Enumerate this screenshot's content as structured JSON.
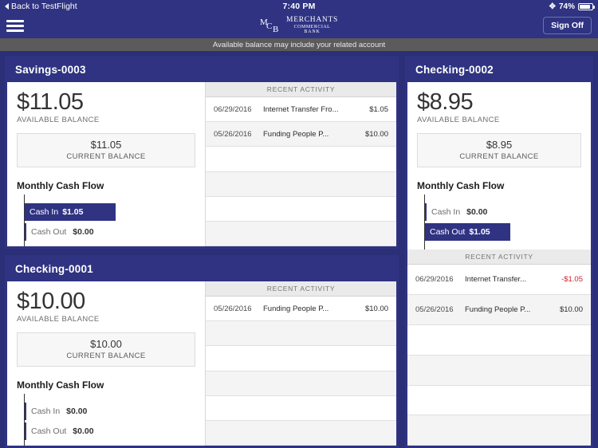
{
  "status_bar": {
    "back_label": "Back to TestFlight",
    "back_icon": "triangle-left-icon",
    "time": "7:40 PM",
    "bluetooth_icon": "bluetooth-icon",
    "battery_percent": "74%",
    "battery_icon": "battery-icon"
  },
  "nav_bar": {
    "menu_icon": "hamburger-menu-icon",
    "logo": {
      "monogram_m": "M",
      "monogram_c": "C",
      "monogram_b": "B",
      "line1": "MERCHANTS",
      "line2": "COMMERCIAL",
      "line3": "BANK"
    },
    "sign_off_label": "Sign Off"
  },
  "notice": {
    "text": "Available balance may include your related account"
  },
  "labels": {
    "available_balance": "AVAILABLE BALANCE",
    "current_balance": "CURRENT BALANCE",
    "monthly_cash_flow": "Monthly Cash Flow",
    "cash_in": "Cash In",
    "cash_out": "Cash Out",
    "recent_activity": "RECENT ACTIVITY"
  },
  "colors": {
    "brand_navy": "#2f3382",
    "page_background": "#2b2f78",
    "notice_gray": "#5b5b5b",
    "negative_amount": "#d0202e",
    "row_alt": "#f4f4f4"
  },
  "accounts": [
    {
      "id": "savings-0003",
      "title": "Savings-0003",
      "available_balance": "$11.05",
      "current_balance": "$11.05",
      "cash_in": "$1.05",
      "cash_out": "$0.00",
      "cash_in_filled": true,
      "cash_out_filled": false,
      "transactions": [
        {
          "date": "06/29/2016",
          "description": "Internet Transfer Fro...",
          "amount": "$1.05",
          "negative": false
        },
        {
          "date": "05/26/2016",
          "description": "Funding People P...",
          "amount": "$10.00",
          "negative": false
        }
      ],
      "empty_rows": 4
    },
    {
      "id": "checking-0001",
      "title": "Checking-0001",
      "available_balance": "$10.00",
      "current_balance": "$10.00",
      "cash_in": "$0.00",
      "cash_out": "$0.00",
      "cash_in_filled": false,
      "cash_out_filled": false,
      "transactions": [
        {
          "date": "05/26/2016",
          "description": "Funding People P...",
          "amount": "$10.00",
          "negative": false
        }
      ],
      "empty_rows": 5
    },
    {
      "id": "checking-0002",
      "title": "Checking-0002",
      "available_balance": "$8.95",
      "current_balance": "$8.95",
      "cash_in": "$0.00",
      "cash_out": "$1.05",
      "cash_in_filled": false,
      "cash_out_filled": true,
      "transactions": [
        {
          "date": "06/29/2016",
          "description": "Internet Transfer...",
          "amount": "-$1.05",
          "negative": true
        },
        {
          "date": "05/26/2016",
          "description": "Funding People P...",
          "amount": "$10.00",
          "negative": false
        }
      ],
      "empty_rows": 4
    }
  ]
}
